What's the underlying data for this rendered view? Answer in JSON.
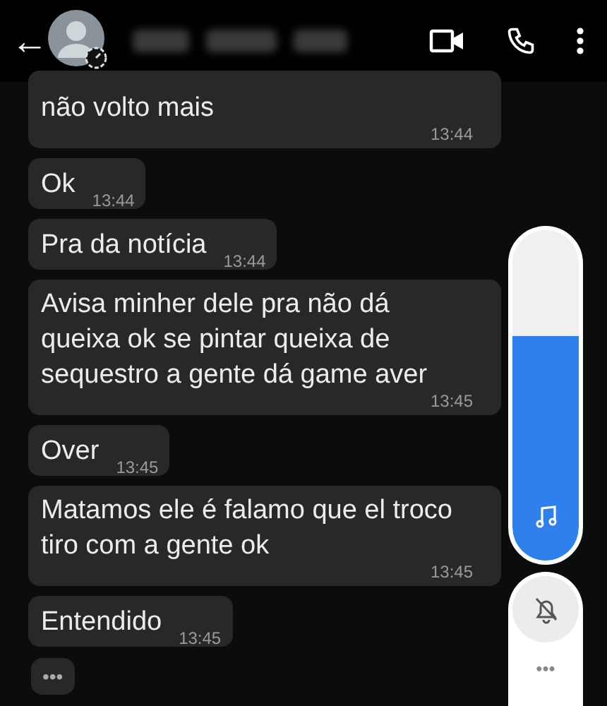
{
  "header": {
    "back": "←"
  },
  "messages": [
    {
      "text": "não volto mais",
      "time": "13:44",
      "kind": "cut"
    },
    {
      "text": "Ok",
      "time": "13:44",
      "kind": "inline"
    },
    {
      "text": "Pra da notícia",
      "time": "13:44",
      "kind": "inline"
    },
    {
      "text": "Avisa minher dele pra não dá queixa ok se pintar queixa de sequestro a gente dá game aver",
      "time": "13:45",
      "kind": "block"
    },
    {
      "text": "Over",
      "time": "13:45",
      "kind": "inline"
    },
    {
      "text": "Matamos ele é falamo que el troco tiro com a gente ok",
      "time": "13:45",
      "kind": "block"
    },
    {
      "text": "Entendido",
      "time": "13:45",
      "kind": "inline"
    }
  ],
  "typing": "•••",
  "volume_panel": {
    "level": 0.68,
    "more": "•••"
  }
}
